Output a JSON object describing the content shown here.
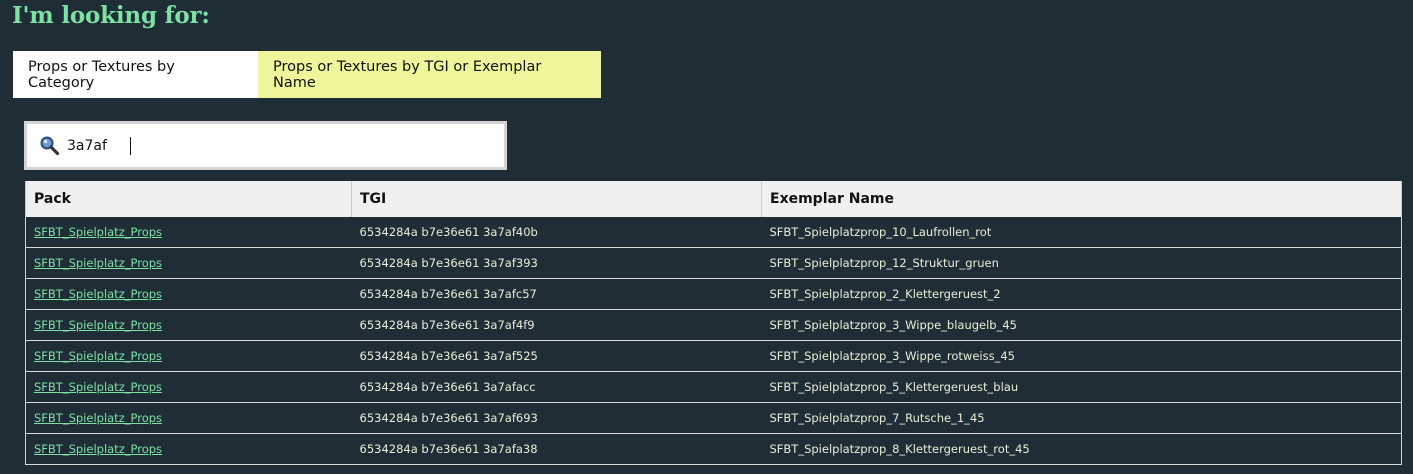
{
  "heading": "I'm looking for:",
  "tabs": {
    "category": "Props or Textures by Category",
    "tgi": "Props or Textures by TGI or Exemplar Name"
  },
  "search": {
    "value": "3a7af",
    "icon": "magnifier-icon"
  },
  "table": {
    "headers": {
      "pack": "Pack",
      "tgi": "TGI",
      "exemplar": "Exemplar Name"
    },
    "rows": [
      {
        "pack": "SFBT_Spielplatz_Props",
        "tgi": "6534284a b7e36e61 3a7af40b",
        "exemplar": "SFBT_Spielplatzprop_10_Laufrollen_rot"
      },
      {
        "pack": "SFBT_Spielplatz_Props",
        "tgi": "6534284a b7e36e61 3a7af393",
        "exemplar": "SFBT_Spielplatzprop_12_Struktur_gruen"
      },
      {
        "pack": "SFBT_Spielplatz_Props",
        "tgi": "6534284a b7e36e61 3a7afc57",
        "exemplar": "SFBT_Spielplatzprop_2_Klettergeruest_2"
      },
      {
        "pack": "SFBT_Spielplatz_Props",
        "tgi": "6534284a b7e36e61 3a7af4f9",
        "exemplar": "SFBT_Spielplatzprop_3_Wippe_blaugelb_45"
      },
      {
        "pack": "SFBT_Spielplatz_Props",
        "tgi": "6534284a b7e36e61 3a7af525",
        "exemplar": "SFBT_Spielplatzprop_3_Wippe_rotweiss_45"
      },
      {
        "pack": "SFBT_Spielplatz_Props",
        "tgi": "6534284a b7e36e61 3a7afacc",
        "exemplar": "SFBT_Spielplatzprop_5_Klettergeruest_blau"
      },
      {
        "pack": "SFBT_Spielplatz_Props",
        "tgi": "6534284a b7e36e61 3a7af693",
        "exemplar": "SFBT_Spielplatzprop_7_Rutsche_1_45"
      },
      {
        "pack": "SFBT_Spielplatz_Props",
        "tgi": "6534284a b7e36e61 3a7afa38",
        "exemplar": "SFBT_Spielplatzprop_8_Klettergeruest_rot_45"
      }
    ]
  },
  "colors": {
    "background": "#1f2d37",
    "heading": "#7ee0a3",
    "active_tab": "#eef59b",
    "link": "#7ee0a3"
  }
}
